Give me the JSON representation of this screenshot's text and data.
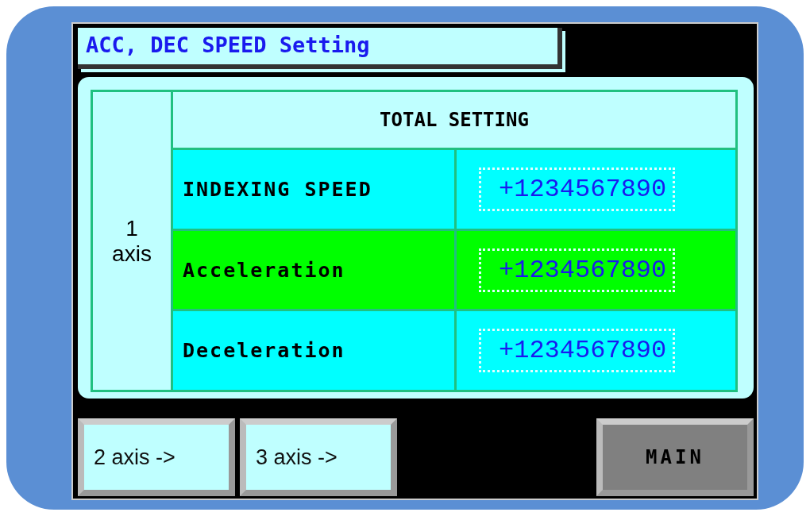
{
  "title": "ACC, DEC SPEED Setting",
  "table": {
    "axis_label": [
      "1",
      "axis"
    ],
    "header": "TOTAL SETTING",
    "rows": [
      {
        "label": "INDEXING SPEED",
        "value": "+1234567890",
        "selected": false
      },
      {
        "label": "Acceleration",
        "value": "+1234567890",
        "selected": true
      },
      {
        "label": "Deceleration",
        "value": "+1234567890",
        "selected": false
      }
    ]
  },
  "buttons": [
    {
      "label": "2 axis ->",
      "kind": "nav"
    },
    {
      "label": "3 axis ->",
      "kind": "nav"
    },
    {
      "label": "MAIN",
      "kind": "main"
    }
  ]
}
